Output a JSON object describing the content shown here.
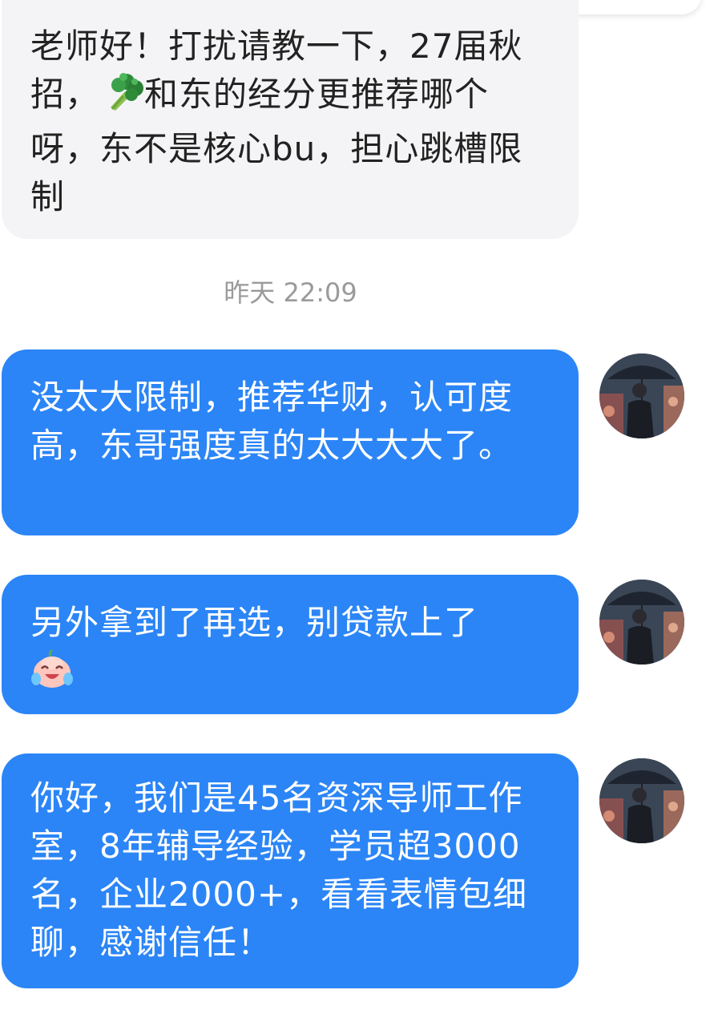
{
  "messages": {
    "incoming_1": {
      "text_before": "老师好！打扰请教一下，27届秋招，",
      "emoji_icon": "broccoli-icon",
      "text_after": "和东的经分更推荐哪个呀，东不是核心bu，担心跳槽限制"
    },
    "timestamp": "昨天 22:09",
    "outgoing": [
      {
        "text": "没太大限制，推荐华财，认可度高，东哥强度真的太大大大了。"
      },
      {
        "text": "另外拿到了再选，别贷款上了",
        "emoji_icon": "laughing-crying-face-icon"
      },
      {
        "text": "你好，我们是45名资深导师工作室，8年辅导经验，学员超3000名，企业2000+，看看表情包细聊，感谢信任！"
      }
    ]
  },
  "colors": {
    "outgoing_bubble": "#2b85f6",
    "incoming_bubble": "#f4f4f6",
    "timestamp_text": "#9a9a9a"
  },
  "avatar": {
    "icon": "user-avatar-person-with-umbrella"
  }
}
